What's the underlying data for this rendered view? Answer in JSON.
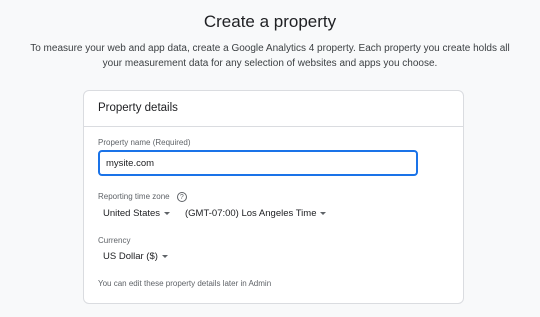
{
  "page": {
    "title": "Create a property",
    "description": "To measure your web and app data, create a Google Analytics 4 property. Each property you create holds all your measurement data for any selection of websites and apps you choose."
  },
  "card": {
    "header": "Property details",
    "property_name": {
      "label": "Property name (Required)",
      "value": "mysite.com"
    },
    "time_zone": {
      "label": "Reporting time zone",
      "help_glyph": "?",
      "country": "United States",
      "zone": "(GMT-07:00) Los Angeles Time"
    },
    "currency": {
      "label": "Currency",
      "value": "US Dollar ($)"
    },
    "footnote": "You can edit these property details later in Admin"
  },
  "colors": {
    "accent": "#1a73e8",
    "background": "#f8f9fa",
    "border": "#dadce0"
  }
}
